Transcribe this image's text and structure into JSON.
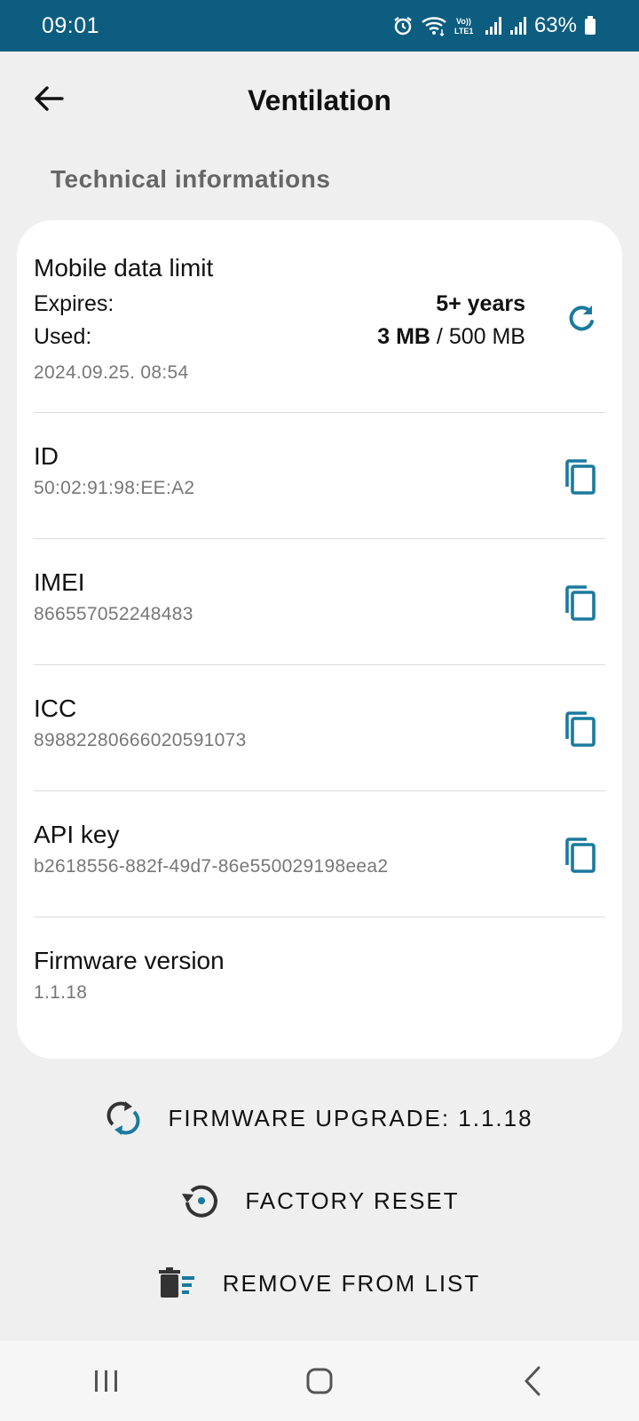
{
  "status_bar": {
    "time": "09:01",
    "battery": "63%",
    "icons": [
      "alarm-icon",
      "wifi-icon",
      "volte-icon",
      "signal-icon",
      "signal-icon",
      "battery-icon"
    ]
  },
  "header": {
    "title": "Ventilation"
  },
  "section_title": "Technical informations",
  "colors": {
    "accent": "#1a7a9e",
    "status_bar": "#0d5d80",
    "background": "#efefef"
  },
  "mobile_data": {
    "title": "Mobile data limit",
    "expires_label": "Expires:",
    "expires_value": "5+ years",
    "used_label": "Used:",
    "used_value": "3 MB",
    "used_separator": " / ",
    "used_total": "500 MB",
    "timestamp": "2024.09.25. 08:54"
  },
  "info_rows": [
    {
      "title": "ID",
      "value": "50:02:91:98:EE:A2"
    },
    {
      "title": "IMEI",
      "value": "866557052248483"
    },
    {
      "title": "ICC",
      "value": "89882280666020591073"
    },
    {
      "title": "API key",
      "value": "b2618556-882f-49d7-86e550029198eea2"
    }
  ],
  "firmware": {
    "title": "Firmware version",
    "value": "1.1.18"
  },
  "actions": {
    "upgrade": "FIRMWARE UPGRADE: 1.1.18",
    "reset": "FACTORY RESET",
    "remove": "REMOVE FROM LIST"
  }
}
